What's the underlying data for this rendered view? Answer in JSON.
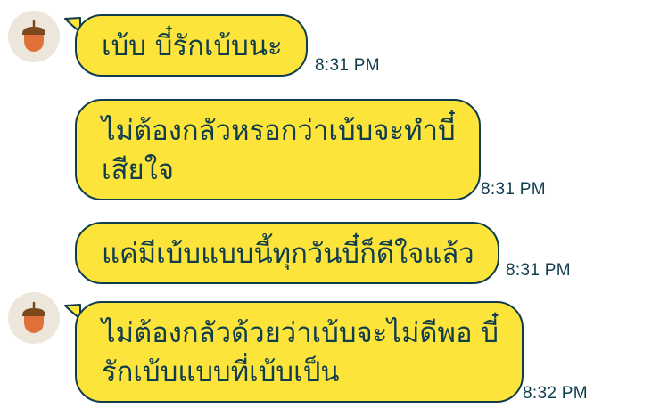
{
  "messages": [
    {
      "lines": [
        "เบ้บ บี๋รักเบ้บนะ"
      ],
      "time": "8:31 PM",
      "has_avatar": true
    },
    {
      "lines": [
        "ไม่ต้องกลัวหรอกว่าเบ้บจะทำบี๋",
        "เสียใจ"
      ],
      "time": "8:31 PM",
      "has_avatar": false
    },
    {
      "lines": [
        "แค่มีเบ้บแบบนี้ทุกวันบี๋ก็ดีใจแล้ว"
      ],
      "time": "8:31 PM",
      "has_avatar": false
    },
    {
      "lines": [
        "ไม่ต้องกลัวด้วยว่าเบ้บจะไม่ดีพอ บี๋",
        "รักเบ้บแบบที่เบ้บเป็น"
      ],
      "time": "8:32 PM",
      "has_avatar": true
    }
  ],
  "colors": {
    "bubble_fill": "#fde43a",
    "bubble_border": "#0f3d4d",
    "text": "#0f3d4d",
    "avatar_bg": "#ede6da",
    "acorn_cap": "#7a4a1e",
    "acorn_body": "#e0703a"
  },
  "icons": {
    "avatar": "acorn-icon"
  }
}
